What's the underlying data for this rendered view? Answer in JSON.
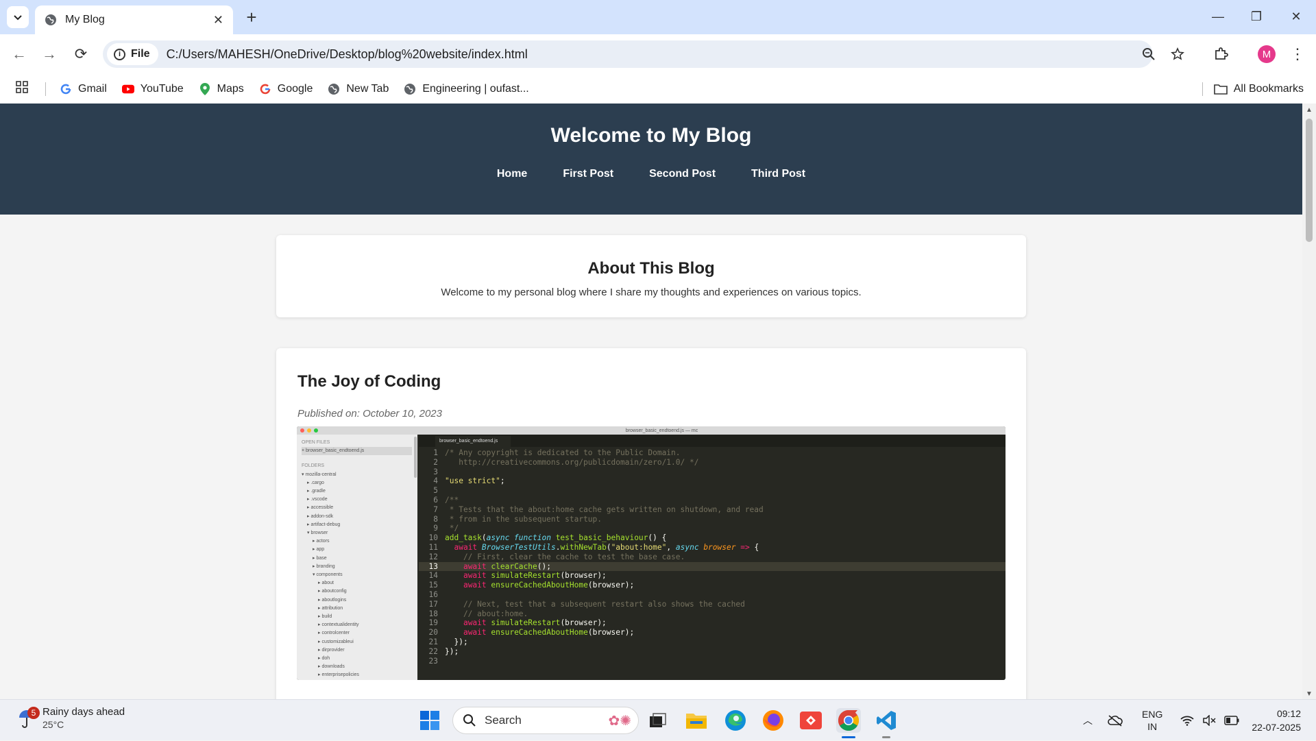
{
  "browser": {
    "tab_title": "My Blog",
    "file_label": "File",
    "url": "C:/Users/MAHESH/OneDrive/Desktop/blog%20website/index.html",
    "profile_initial": "M",
    "bookmarks": [
      {
        "label": "Gmail",
        "icon": "google-icon"
      },
      {
        "label": "YouTube",
        "icon": "youtube-icon"
      },
      {
        "label": "Maps",
        "icon": "maps-icon"
      },
      {
        "label": "Google",
        "icon": "google-icon"
      },
      {
        "label": "New Tab",
        "icon": "globe-icon"
      },
      {
        "label": "Engineering | oufast...",
        "icon": "globe-icon"
      }
    ],
    "all_bookmarks": "All Bookmarks"
  },
  "site": {
    "title": "Welcome to My Blog",
    "nav": [
      "Home",
      "First Post",
      "Second Post",
      "Third Post"
    ],
    "about": {
      "heading": "About This Blog",
      "text": "Welcome to my personal blog where I share my thoughts and experiences on various topics."
    },
    "post": {
      "title": "The Joy of Coding",
      "date": "Published on: October 10, 2023"
    }
  },
  "screenshot": {
    "window_title": "browser_basic_endtoend.js — mc",
    "tab": "browser_basic_endtoend.js",
    "open_files_label": "OPEN FILES",
    "open_file": "× browser_basic_endtoend.js",
    "folders_label": "FOLDERS",
    "folders": [
      "▾ mozilla-central",
      "▸ .cargo",
      "▸ .gradle",
      "▸ .vscode",
      "▸ accessible",
      "▸ addon-sdk",
      "▸ artifact-debug",
      "▾ browser",
      "▸ actors",
      "▸ app",
      "▸ base",
      "▸ branding",
      "▾ components",
      "▸ about",
      "▸ aboutconfig",
      "▸ aboutlogins",
      "▸ attribution",
      "▸ build",
      "▸ contextualidentity",
      "▸ controlcenter",
      "▸ customizableui",
      "▸ dirprovider",
      "▸ doh",
      "▸ downloads",
      "▸ enterprisepolicies"
    ],
    "code_lines": [
      "/* Any copyright is dedicated to the Public Domain.",
      "   http://creativecommons.org/publicdomain/zero/1.0/ */",
      "",
      "\"use strict\";",
      "",
      "/**",
      " * Tests that the about:home cache gets written on shutdown, and read",
      " * from in the subsequent startup.",
      " */",
      "add_task(async function test_basic_behaviour() {",
      "  await BrowserTestUtils.withNewTab(\"about:home\", async browser => {",
      "    // First, clear the cache to test the base case.",
      "    await clearCache();",
      "    await simulateRestart(browser);",
      "    await ensureCachedAboutHome(browser);",
      "",
      "    // Next, test that a subsequent restart also shows the cached",
      "    // about:home.",
      "    await simulateRestart(browser);",
      "    await ensureCachedAboutHome(browser);",
      "  });",
      "});",
      ""
    ]
  },
  "taskbar": {
    "weather_title": "Rainy days ahead",
    "weather_temp": "25°C",
    "weather_badge": "5",
    "search_placeholder": "Search",
    "lang_top": "ENG",
    "lang_bottom": "IN",
    "time": "09:12",
    "date": "22-07-2025"
  },
  "colors": {
    "header_bg": "#2c3e50",
    "tab_strip": "#d3e3fd",
    "profile": "#e5398b"
  }
}
